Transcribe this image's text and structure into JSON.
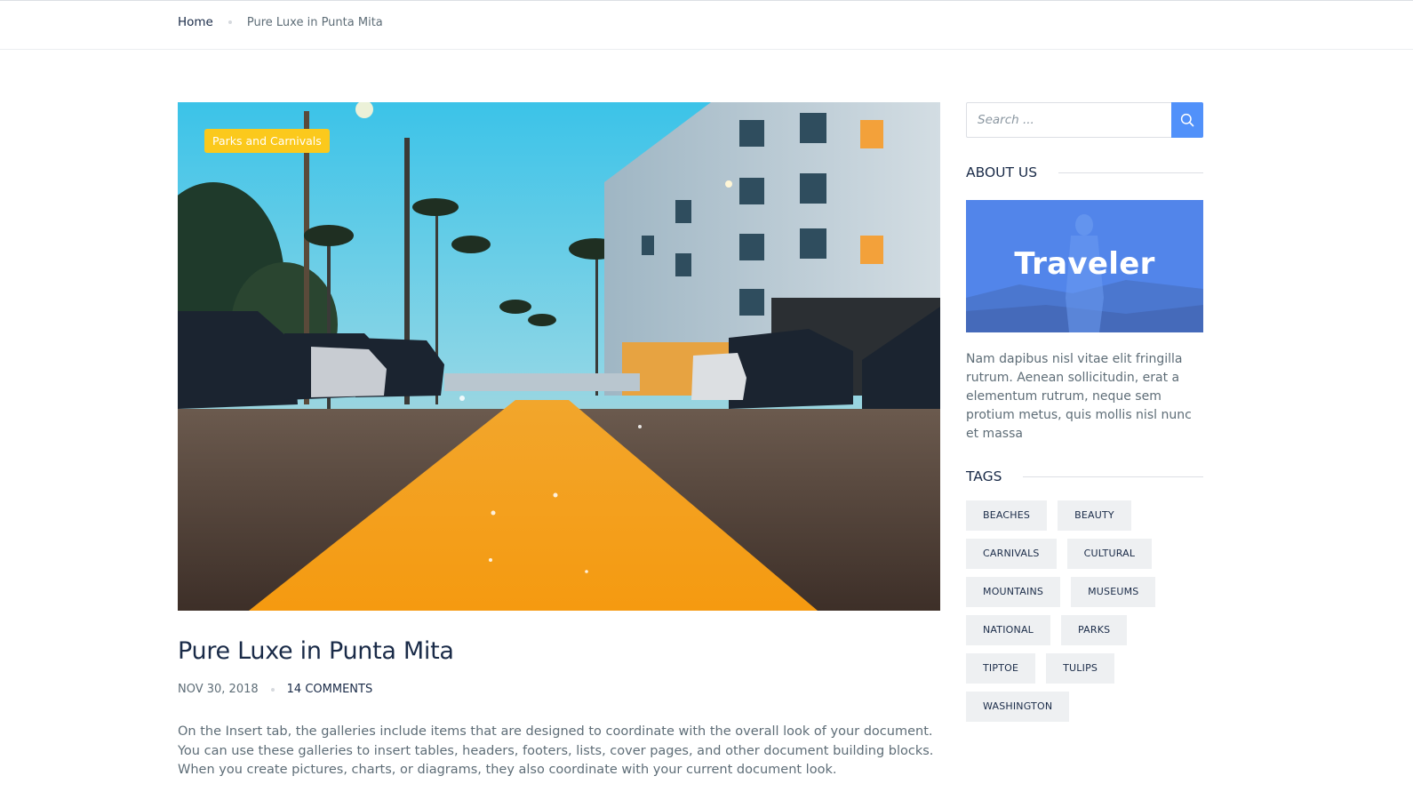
{
  "breadcrumb": {
    "home": "Home",
    "current": "Pure Luxe in Punta Mita"
  },
  "post": {
    "category": "Parks and Carnivals",
    "title": "Pure Luxe in Punta Mita",
    "date": "NOV 30, 2018",
    "comments": "14 COMMENTS",
    "excerpt": "On the Insert tab, the galleries include items that are designed to coordinate with the overall look of your document. You can use these galleries to insert tables, headers, footers, lists, cover pages, and other document building blocks. When you create pictures, charts, or diagrams, they also coordinate with your current document look."
  },
  "sidebar": {
    "search": {
      "placeholder": "Search ..."
    },
    "about": {
      "title": "ABOUT US",
      "banner_text": "Traveler",
      "text": "Nam dapibus nisl vitae elit fringilla rutrum. Aenean sollicitudin, erat a elementum rutrum, neque sem protium metus, quis mollis nisl nunc et massa"
    },
    "tags": {
      "title": "TAGS",
      "items": [
        "BEACHES",
        "BEAUTY",
        "CARNIVALS",
        "CULTURAL",
        "MOUNTAINS",
        "MUSEUMS",
        "NATIONAL",
        "PARKS",
        "TIPTOE",
        "TULIPS",
        "WASHINGTON"
      ]
    }
  },
  "colors": {
    "accent": "#5191fa",
    "badge": "#fbc91c",
    "heading": "#1a2b48",
    "body_text": "#5e6d77",
    "tag_bg": "#eef0f2"
  },
  "icons": {
    "search_button": "search-icon"
  }
}
